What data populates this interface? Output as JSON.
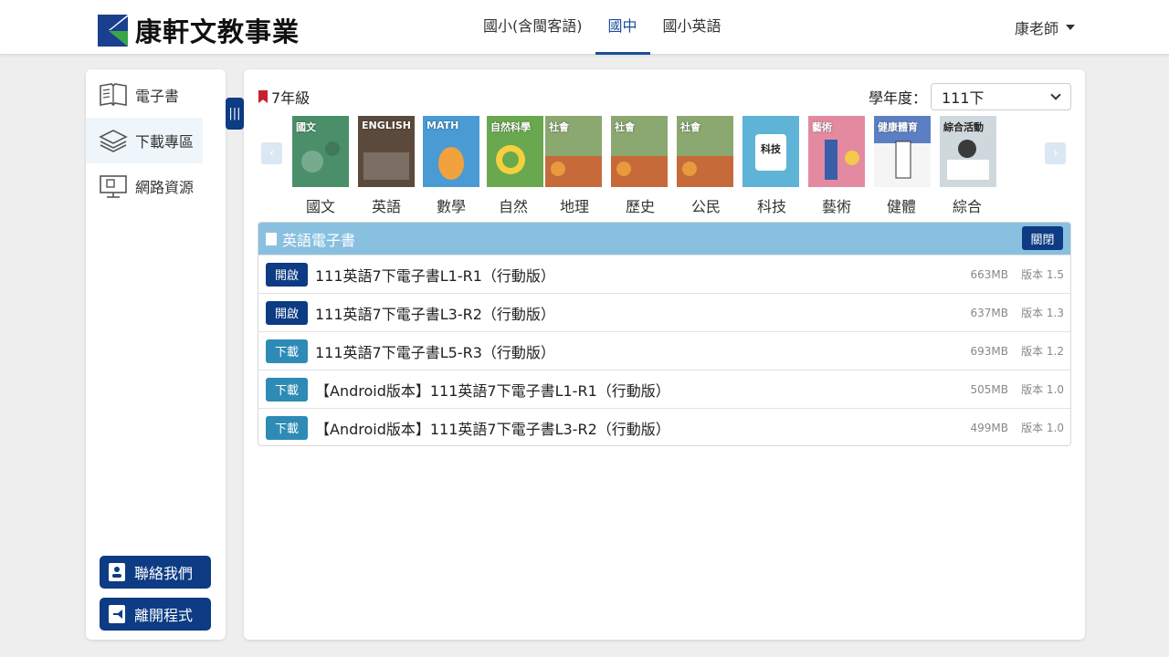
{
  "header": {
    "logo_text": "康軒文教事業",
    "nav": [
      {
        "label": "國小(含閩客語)",
        "active": false
      },
      {
        "label": "國中",
        "active": true
      },
      {
        "label": "國小英語",
        "active": false
      }
    ],
    "user": "康老師"
  },
  "sidebar": {
    "items": [
      {
        "label": "電子書",
        "icon": "book-open-icon",
        "active": false
      },
      {
        "label": "下載專區",
        "icon": "layers-icon",
        "active": true
      },
      {
        "label": "網路資源",
        "icon": "monitor-icon",
        "active": false
      }
    ],
    "contact_label": "聯絡我們",
    "exit_label": "離開程式",
    "toggle_glyph": "|||"
  },
  "main": {
    "grade": "7年級",
    "year_label": "學年度：",
    "year_value": "111下",
    "prev_glyph": "‹",
    "next_glyph": "›",
    "subjects": [
      {
        "label": "國文",
        "cover_title": "國文",
        "color": "#4a8f6a"
      },
      {
        "label": "英語",
        "cover_title": "ENGLISH",
        "color": "#5b4a3c"
      },
      {
        "label": "數學",
        "cover_title": "MATH",
        "color": "#4a9bd4"
      },
      {
        "label": "自然",
        "cover_title": "自然科學",
        "color": "#6aa84f"
      },
      {
        "label": "地理",
        "cover_title": "社會",
        "color": "#8aa870"
      },
      {
        "label": "歷史",
        "cover_title": "社會",
        "color": "#8aa870"
      },
      {
        "label": "公民",
        "cover_title": "社會",
        "color": "#8aa870"
      },
      {
        "label": "科技",
        "cover_title": "科技",
        "color": "#5fb3d6"
      },
      {
        "label": "藝術",
        "cover_title": "藝術",
        "color": "#e38aa0"
      },
      {
        "label": "健體",
        "cover_title": "健康體育",
        "color": "#5c7fc4"
      },
      {
        "label": "綜合",
        "cover_title": "綜合活動",
        "color": "#cfd8dc"
      }
    ],
    "panel": {
      "title": "英語電子書",
      "close_label": "關閉",
      "rows": [
        {
          "action": "開啟",
          "type": "open",
          "title": "111英語7下電子書L1-R1（行動版）",
          "size": "663MB",
          "version": "版本 1.5"
        },
        {
          "action": "開啟",
          "type": "open",
          "title": "111英語7下電子書L3-R2（行動版）",
          "size": "637MB",
          "version": "版本 1.3"
        },
        {
          "action": "下載",
          "type": "dl",
          "title": "111英語7下電子書L5-R3（行動版）",
          "size": "693MB",
          "version": "版本 1.2"
        },
        {
          "action": "下載",
          "type": "dl",
          "title": "【Android版本】111英語7下電子書L1-R1（行動版）",
          "size": "505MB",
          "version": "版本 1.0"
        },
        {
          "action": "下載",
          "type": "dl",
          "title": "【Android版本】111英語7下電子書L3-R2（行動版）",
          "size": "499MB",
          "version": "版本 1.0"
        }
      ]
    }
  }
}
